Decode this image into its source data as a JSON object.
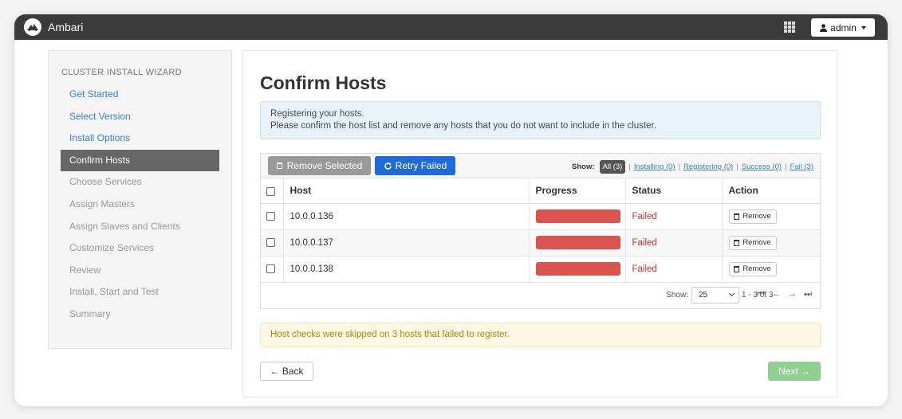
{
  "app": {
    "name": "Ambari",
    "user_label": "admin"
  },
  "sidebar": {
    "title": "CLUSTER INSTALL WIZARD",
    "items": [
      {
        "label": "Get Started",
        "state": "done"
      },
      {
        "label": "Select Version",
        "state": "done"
      },
      {
        "label": "Install Options",
        "state": "done"
      },
      {
        "label": "Confirm Hosts",
        "state": "active"
      },
      {
        "label": "Choose Services",
        "state": "pending"
      },
      {
        "label": "Assign Masters",
        "state": "pending"
      },
      {
        "label": "Assign Slaves and Clients",
        "state": "pending"
      },
      {
        "label": "Customize Services",
        "state": "pending"
      },
      {
        "label": "Review",
        "state": "pending"
      },
      {
        "label": "Install, Start and Test",
        "state": "pending"
      },
      {
        "label": "Summary",
        "state": "pending"
      }
    ]
  },
  "main": {
    "title": "Confirm Hosts",
    "info_line1": "Registering your hosts.",
    "info_line2": "Please confirm the host list and remove any hosts that you do not want to include in the cluster.",
    "toolbar": {
      "remove_selected": "Remove Selected",
      "retry_failed": "Retry Failed",
      "show_label": "Show:",
      "filters": [
        "All (3)",
        "Installing (0)",
        "Registering (0)",
        "Success (0)",
        "Fail (3)"
      ]
    },
    "table": {
      "headers": [
        "Host",
        "Progress",
        "Status",
        "Action"
      ],
      "rows": [
        {
          "host": "10.0.0.136",
          "progress": 1.0,
          "status": "Failed",
          "action": "Remove"
        },
        {
          "host": "10.0.0.137",
          "progress": 1.0,
          "status": "Failed",
          "action": "Remove"
        },
        {
          "host": "10.0.0.138",
          "progress": 1.0,
          "status": "Failed",
          "action": "Remove"
        }
      ]
    },
    "pagination": {
      "show_label": "Show:",
      "page_size": "25",
      "range": "1 - 3 of 3"
    },
    "warning": "Host checks were skipped on 3 hosts that failed to register.",
    "back_label": "← Back",
    "next_label": "Next →"
  },
  "colors": {
    "topbar": "#3b3b3b",
    "link": "#3a7fd4",
    "primary": "#1f6ad6",
    "failed": "#d9534f",
    "next": "#8fcf8f"
  }
}
